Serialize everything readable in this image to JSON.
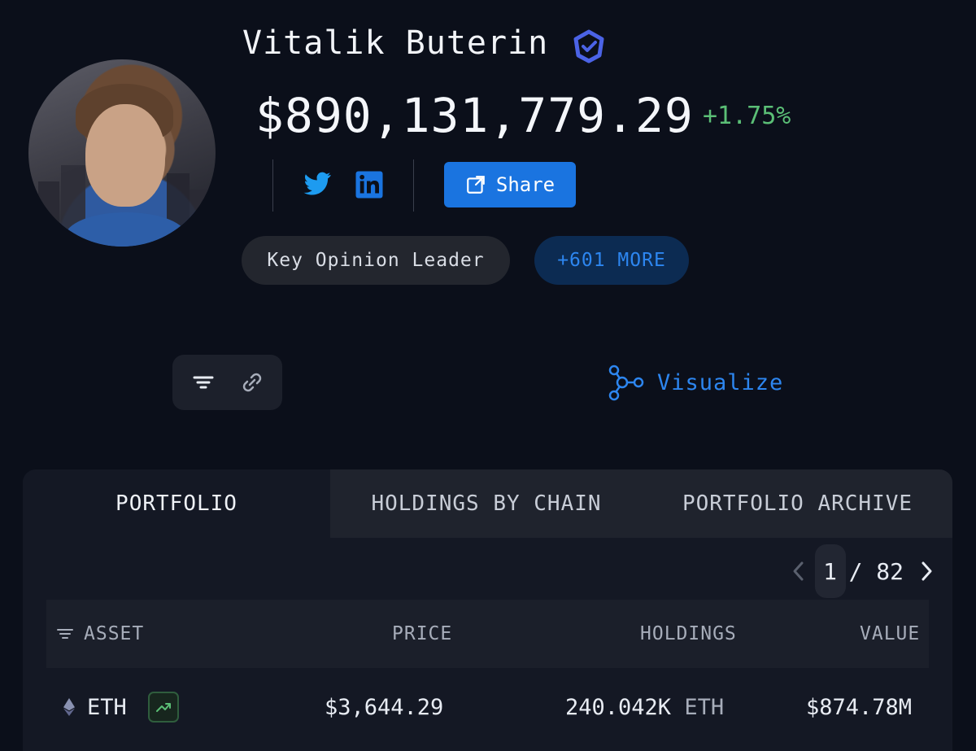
{
  "profile": {
    "name": "Vitalik Buterin",
    "net_value": "$890,131,779.29",
    "change_pct": "+1.75%",
    "share_label": "Share",
    "tags": {
      "primary": "Key Opinion Leader",
      "more": "+601 MORE"
    }
  },
  "toolbar": {
    "visualize_label": "Visualize"
  },
  "tabs": [
    {
      "label": "PORTFOLIO",
      "active": true
    },
    {
      "label": "HOLDINGS BY CHAIN",
      "active": false
    },
    {
      "label": "PORTFOLIO ARCHIVE",
      "active": false
    }
  ],
  "pagination": {
    "current": "1",
    "total": "/ 82"
  },
  "table": {
    "columns": [
      "ASSET",
      "PRICE",
      "HOLDINGS",
      "VALUE"
    ],
    "rows": [
      {
        "asset": "ETH",
        "price": "$3,644.29",
        "holdings": "240.042K",
        "holdings_unit": "ETH",
        "value": "$874.78M"
      }
    ]
  },
  "icons": {
    "verified": "verified-badge-icon",
    "twitter": "twitter-icon",
    "linkedin": "linkedin-icon",
    "share": "external-link-icon",
    "filter": "filter-icon",
    "link": "link-icon",
    "visualize": "graph-nodes-icon",
    "eth": "ethereum-icon",
    "trend": "trend-up-icon"
  },
  "colors": {
    "background": "#0b0f1a",
    "accent": "#1a74e0",
    "positive": "#5bbf76"
  }
}
